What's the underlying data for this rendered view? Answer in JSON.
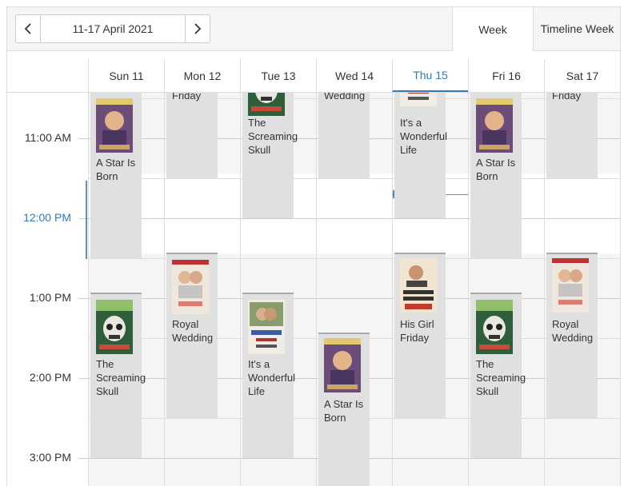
{
  "toolbar": {
    "prev_icon": "chevron-left-icon",
    "next_icon": "chevron-right-icon",
    "date_range": "11-17 April 2021",
    "views": [
      "Week",
      "Timeline Week"
    ],
    "selected_view": "Week"
  },
  "days": [
    {
      "label": "Sun 11",
      "today": false
    },
    {
      "label": "Mon 12",
      "today": false
    },
    {
      "label": "Tue 13",
      "today": false
    },
    {
      "label": "Wed 14",
      "today": false
    },
    {
      "label": "Thu 15",
      "today": true
    },
    {
      "label": "Fri 16",
      "today": false
    },
    {
      "label": "Sat 17",
      "today": false
    }
  ],
  "times": [
    "11:00 AM",
    "12:00 PM",
    "1:00 PM",
    "2:00 PM",
    "3:00 PM"
  ],
  "current_time_label": "12:00 PM",
  "accent_color": "#337ab7",
  "posters": {
    "A Star Is Born": {
      "bg": "#6c4d7a",
      "accent": "#c9a46a"
    },
    "The Screaming Skull": {
      "bg": "#2f5e3a",
      "accent": "#e8e8e0"
    },
    "It's a Wonderful Life": {
      "bg": "#f1ede4",
      "accent": "#3b5aa8"
    },
    "Royal Wedding": {
      "bg": "#efe6dc",
      "accent": "#d94b43"
    },
    "His Girl Friday": {
      "bg": "#f0e5d0",
      "accent": "#c23a2a"
    }
  },
  "events": [
    {
      "day": 0,
      "title": "A Star Is Born",
      "show_poster": true
    },
    {
      "day": 0,
      "title": "The Screaming Skull",
      "show_poster": true
    },
    {
      "day": 1,
      "title": "Friday",
      "show_poster": false
    },
    {
      "day": 1,
      "title": "Royal Wedding",
      "show_poster": true
    },
    {
      "day": 2,
      "title": "The Screaming Skull",
      "show_poster": true
    },
    {
      "day": 2,
      "title": "It's a Wonderful Life",
      "show_poster": true
    },
    {
      "day": 3,
      "title": "Wedding",
      "show_poster": false
    },
    {
      "day": 3,
      "title": "A Star Is Born",
      "show_poster": true
    },
    {
      "day": 4,
      "title": "It's a Wonderful Life",
      "show_poster": true
    },
    {
      "day": 4,
      "title": "His Girl Friday",
      "show_poster": true
    },
    {
      "day": 5,
      "title": "A Star Is Born",
      "show_poster": true
    },
    {
      "day": 5,
      "title": "The Screaming Skull",
      "show_poster": true
    },
    {
      "day": 6,
      "title": "Friday",
      "show_poster": false
    },
    {
      "day": 6,
      "title": "Royal Wedding",
      "show_poster": true
    }
  ]
}
